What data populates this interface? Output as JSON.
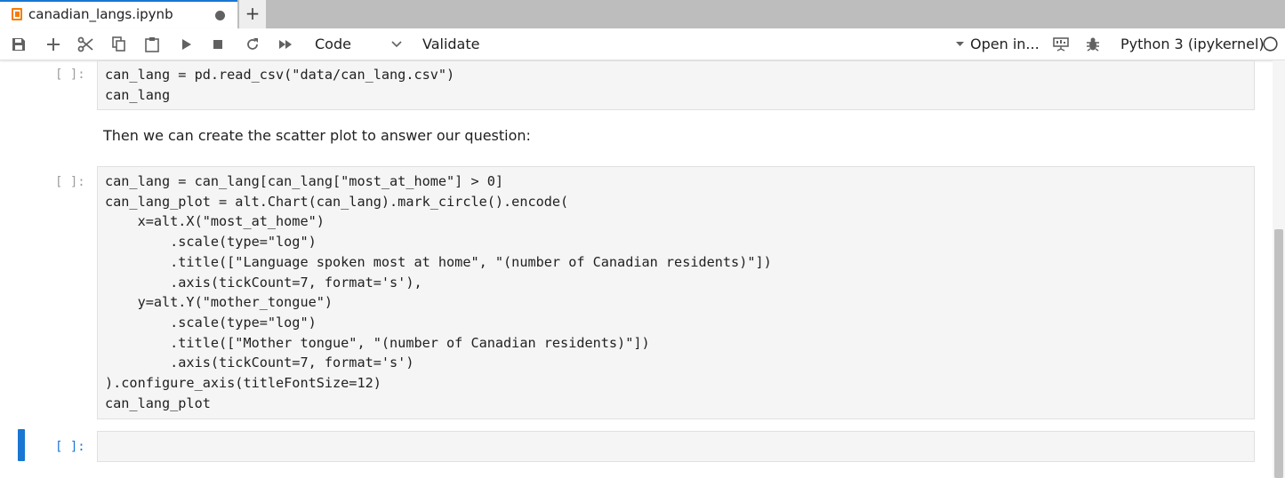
{
  "tab": {
    "title": "canadian_langs.ipynb",
    "new_tab_label": "+"
  },
  "toolbar": {
    "cell_type": "Code",
    "validate_label": "Validate",
    "open_in_label": "Open in...",
    "kernel_label": "Python 3 (ipykernel)",
    "icons": [
      "save-icon",
      "add-cell-icon",
      "cut-icon",
      "copy-icon",
      "paste-icon",
      "run-icon",
      "stop-icon",
      "restart-icon",
      "fast-forward-icon",
      "chevron-down-icon",
      "caret-down-icon",
      "presentation-icon",
      "bug-icon",
      "kernel-status-icon"
    ]
  },
  "cells": [
    {
      "prompt": "[ ]:",
      "lines": [
        "can_lang = pd.read_csv(\"data/can_lang.csv\")",
        "can_lang"
      ]
    },
    {
      "markdown": "Then we can create the scatter plot to answer our question:"
    },
    {
      "prompt": "[ ]:",
      "lines": [
        "can_lang = can_lang[can_lang[\"most_at_home\"] > 0]",
        "can_lang_plot = alt.Chart(can_lang).mark_circle().encode(",
        "    x=alt.X(\"most_at_home\")",
        "        .scale(type=\"log\")",
        "        .title([\"Language spoken most at home\", \"(number of Canadian residents)\"])",
        "        .axis(tickCount=7, format='s'),",
        "    y=alt.Y(\"mother_tongue\")",
        "        .scale(type=\"log\")",
        "        .title([\"Mother tongue\", \"(number of Canadian residents)\"])",
        "        .axis(tickCount=7, format='s')",
        ").configure_axis(titleFontSize=12)",
        "can_lang_plot"
      ]
    },
    {
      "prompt": "[ ]:",
      "lines": []
    }
  ],
  "colors": {
    "accent": "#1976d2",
    "tab_icon": "#f57c00",
    "code_bg": "#f5f5f5"
  }
}
